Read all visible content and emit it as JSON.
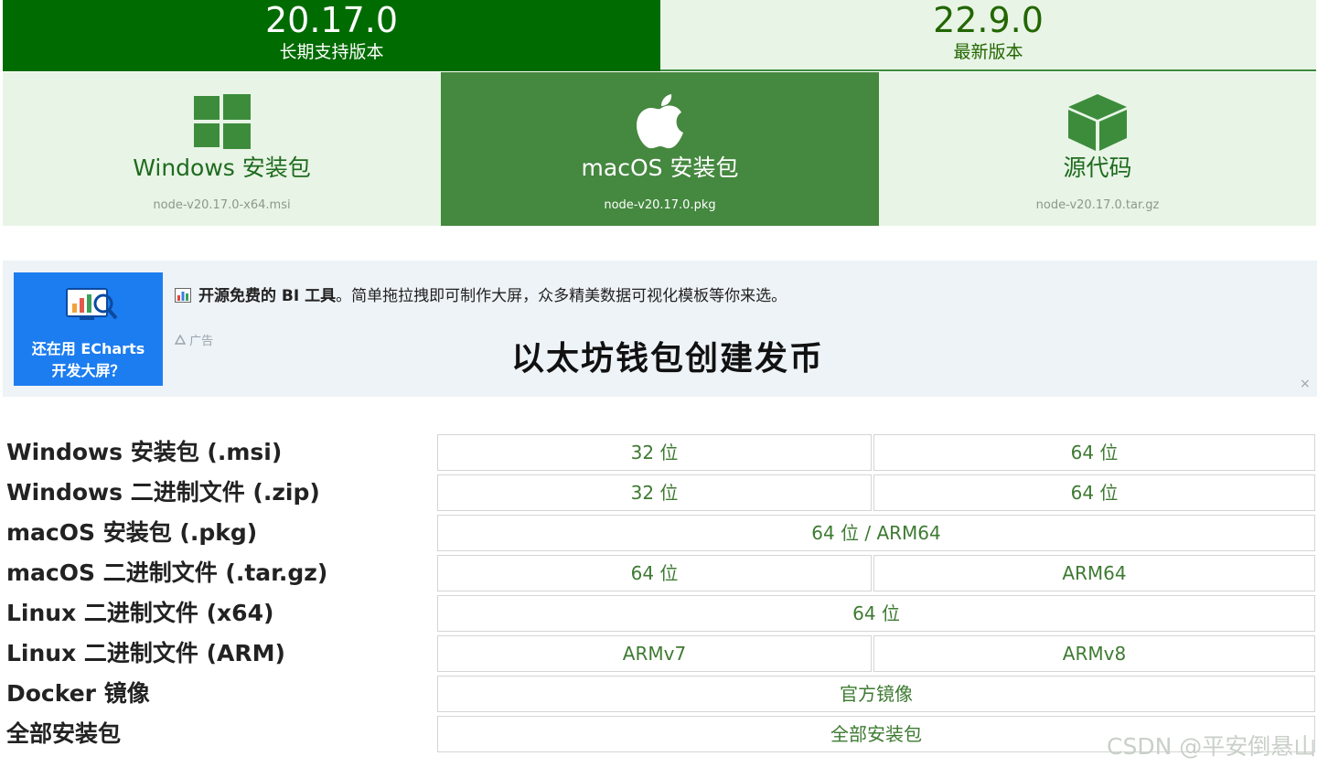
{
  "versions": {
    "lts": {
      "number": "20.17.0",
      "label": "长期支持版本"
    },
    "current": {
      "number": "22.9.0",
      "label": "最新版本"
    }
  },
  "cards": {
    "windows": {
      "title": "Windows 安装包",
      "file": "node-v20.17.0-x64.msi",
      "icon": "windows-logo-icon"
    },
    "macos": {
      "title": "macOS 安装包",
      "file": "node-v20.17.0.pkg",
      "icon": "apple-logo-icon"
    },
    "source": {
      "title": "源代码",
      "file": "node-v20.17.0.tar.gz",
      "icon": "box-icon"
    }
  },
  "ad": {
    "image_line1": "还在用 ECharts",
    "image_line2": "开发大屏？",
    "text_bold": "开源免费的 BI 工具",
    "text_rest": "。简单拖拉拽即可制作大屏，众多精美数据可视化模板等你来选。",
    "mark": "广告",
    "headline": "以太坊钱包创建发币",
    "close": "×"
  },
  "downloads": {
    "rows": [
      {
        "label": "Windows 安装包 (.msi)",
        "cells": [
          "32 位",
          "64 位"
        ]
      },
      {
        "label": "Windows 二进制文件 (.zip)",
        "cells": [
          "32 位",
          "64 位"
        ]
      },
      {
        "label": "macOS 安装包 (.pkg)",
        "cells": [
          "64 位 / ARM64"
        ]
      },
      {
        "label": "macOS 二进制文件 (.tar.gz)",
        "cells": [
          "64 位",
          "ARM64"
        ]
      },
      {
        "label": "Linux 二进制文件 (x64)",
        "cells": [
          "64 位"
        ]
      },
      {
        "label": "Linux 二进制文件 (ARM)",
        "cells": [
          "ARMv7",
          "ARMv8"
        ]
      },
      {
        "label": "Docker 镜像",
        "cells": [
          "官方镜像"
        ]
      },
      {
        "label": "全部安装包",
        "cells": [
          "全部安装包"
        ]
      }
    ]
  },
  "watermark": "CSDN @平安倒悬山"
}
